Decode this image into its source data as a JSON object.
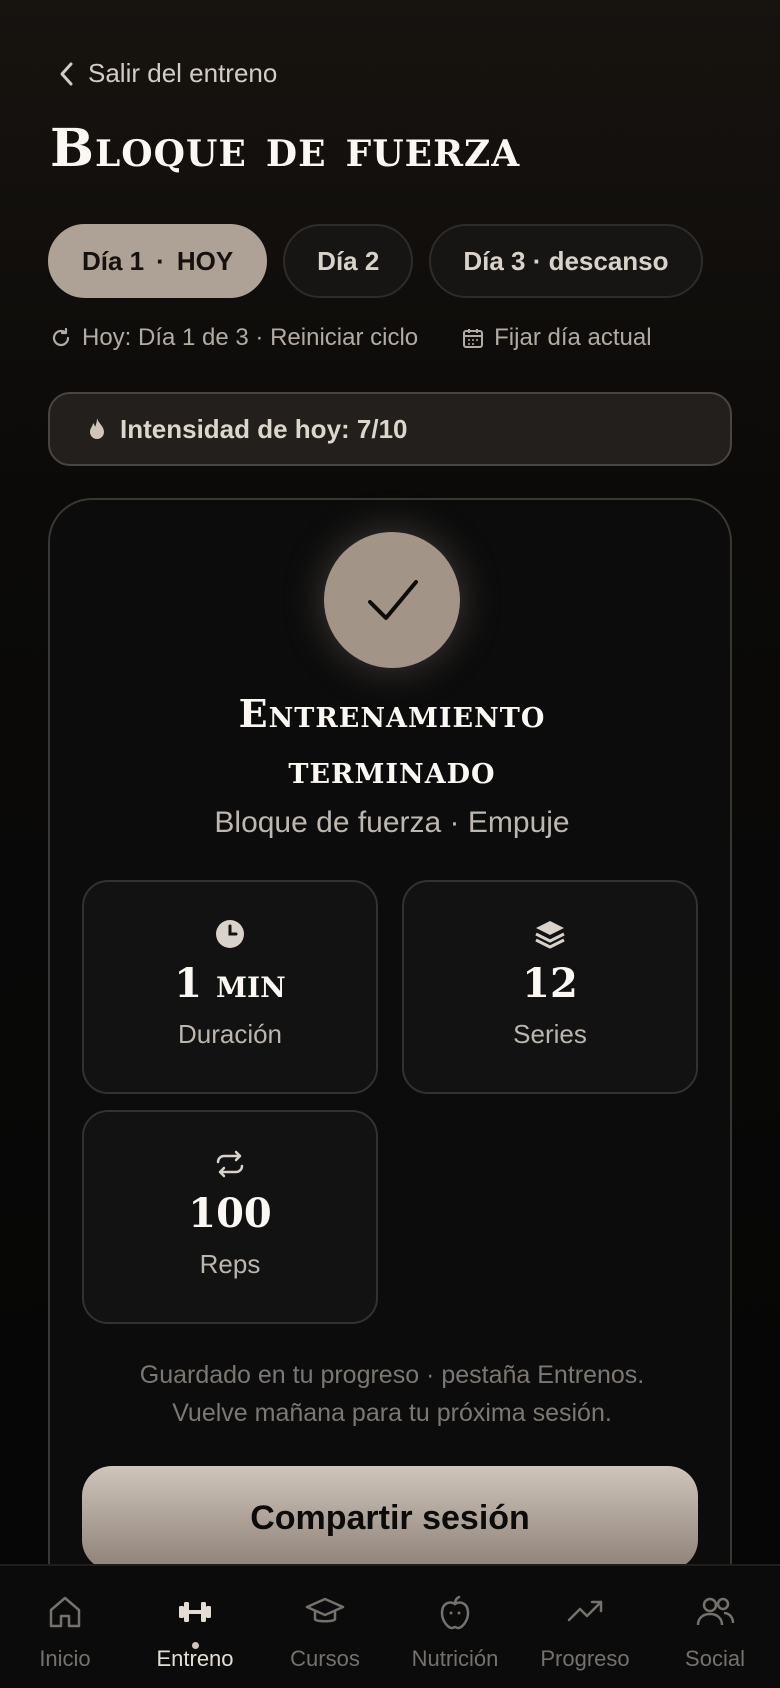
{
  "header": {
    "back_label": "Salir del entreno",
    "title": "Bloque de fuerza"
  },
  "days": [
    {
      "label": "Día 1",
      "tag": "HOY",
      "active": true
    },
    {
      "label": "Día 2"
    },
    {
      "label": "Día 3 · descanso"
    }
  ],
  "cycle": {
    "status": "Hoy: Día 1 de 3 · Reiniciar ciclo",
    "fix_label": "Fijar día actual"
  },
  "intensity": {
    "label": "Intensidad de hoy: 7/10",
    "value": 7,
    "max": 10
  },
  "summary": {
    "title_line1": "Entrenamiento",
    "title_line2": "terminado",
    "subtitle": "Bloque de fuerza · Empuje",
    "stats": [
      {
        "icon": "clock-icon",
        "value": "1 min",
        "label": "Duración"
      },
      {
        "icon": "layers-icon",
        "value": "12",
        "label": "Series"
      },
      {
        "icon": "repeat-icon",
        "value": "100",
        "label": "Reps"
      }
    ],
    "note_line1": "Guardado en tu progreso · pestaña Entrenos.",
    "note_line2": "Vuelve mañana para tu próxima sesión.",
    "share_label": "Compartir sesión"
  },
  "nav": [
    {
      "label": "Inicio",
      "icon": "home-icon"
    },
    {
      "label": "Entreno",
      "icon": "dumbbell-icon",
      "active": true
    },
    {
      "label": "Cursos",
      "icon": "graduation-cap-icon"
    },
    {
      "label": "Nutrición",
      "icon": "apple-icon"
    },
    {
      "label": "Progreso",
      "icon": "trending-up-icon"
    },
    {
      "label": "Social",
      "icon": "users-icon"
    }
  ],
  "colors": {
    "accent": "#aea195",
    "background": "#0b0a09"
  }
}
